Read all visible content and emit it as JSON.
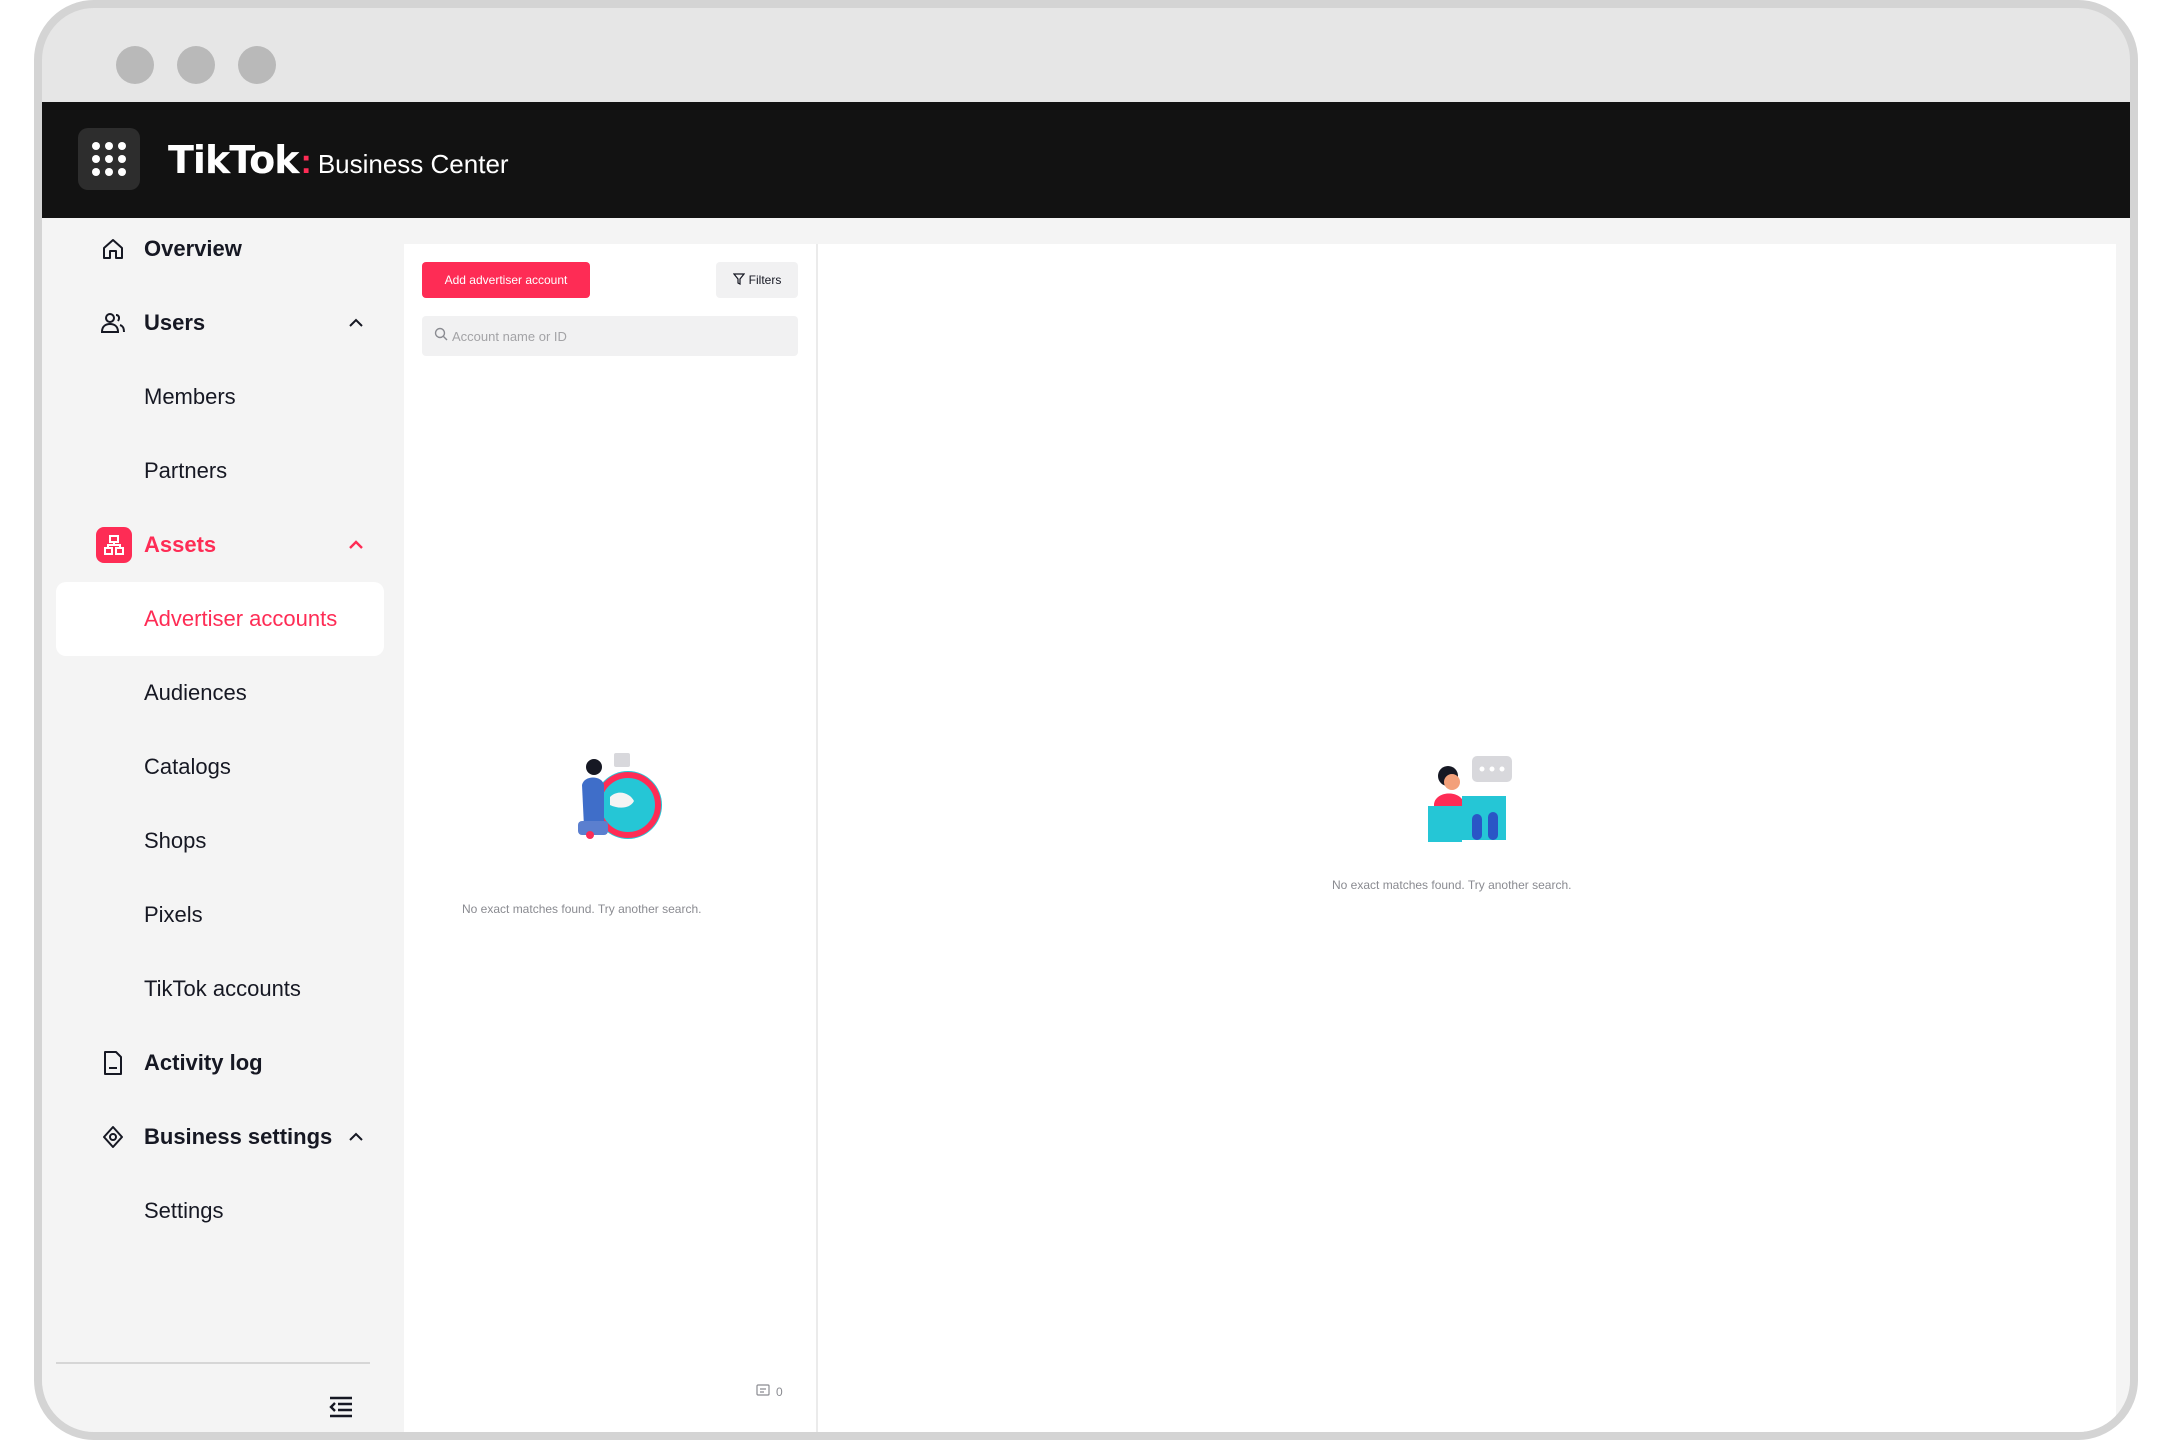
{
  "header": {
    "brand": "TikTok",
    "brand_separator": ":",
    "product": "Business Center",
    "apps_icon": "grid-dots-icon"
  },
  "sidebar": {
    "items": [
      {
        "label": "Overview",
        "icon": "home-icon",
        "level": "top"
      },
      {
        "label": "Users",
        "icon": "users-icon",
        "level": "top",
        "expanded": true
      },
      {
        "label": "Members",
        "level": "sub"
      },
      {
        "label": "Partners",
        "level": "sub"
      },
      {
        "label": "Assets",
        "icon": "assets-icon",
        "level": "top",
        "expanded": true,
        "active": true
      },
      {
        "label": "Advertiser accounts",
        "level": "sub",
        "selected": true
      },
      {
        "label": "Audiences",
        "level": "sub"
      },
      {
        "label": "Catalogs",
        "level": "sub"
      },
      {
        "label": "Shops",
        "level": "sub"
      },
      {
        "label": "Pixels",
        "level": "sub"
      },
      {
        "label": "TikTok accounts",
        "level": "sub"
      },
      {
        "label": "Activity log",
        "icon": "document-icon",
        "level": "top"
      },
      {
        "label": "Business settings",
        "icon": "settings-hexagon-icon",
        "level": "top",
        "expanded": true
      },
      {
        "label": "Settings",
        "level": "sub"
      }
    ],
    "collapse_icon": "collapse-menu-icon"
  },
  "list_panel": {
    "add_button_label": "Add advertiser account",
    "filter_label": "Filters",
    "search_placeholder": "Account name or ID",
    "empty_message": "No exact matches found. Try another search.",
    "count": "0"
  },
  "detail_panel": {
    "empty_message": "No exact matches found. Try another search."
  },
  "colors": {
    "accent": "#fe2c55",
    "header_bg": "#121212",
    "sidebar_bg": "#f4f4f4"
  }
}
